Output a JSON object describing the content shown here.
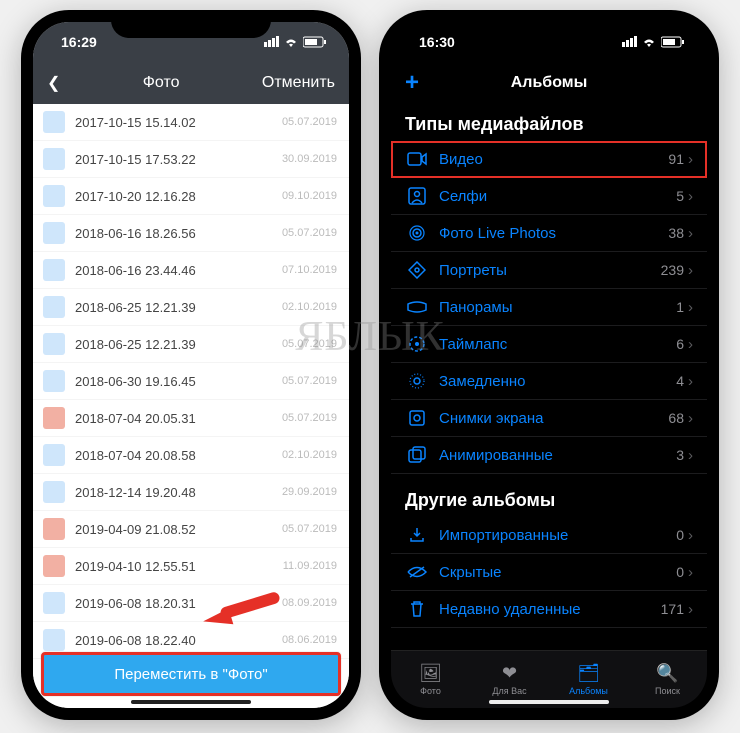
{
  "watermark": "ЯБЛЫК",
  "phone1": {
    "time": "16:29",
    "nav": {
      "title": "Фото",
      "cancel": "Отменить"
    },
    "files": [
      {
        "name": "2017-10-15 15.14.02",
        "date": "05.07.2019",
        "type": "img"
      },
      {
        "name": "2017-10-15 17.53.22",
        "date": "30.09.2019",
        "type": "img"
      },
      {
        "name": "2017-10-20 12.16.28",
        "date": "09.10.2019",
        "type": "img"
      },
      {
        "name": "2018-06-16 18.26.56",
        "date": "05.07.2019",
        "type": "img"
      },
      {
        "name": "2018-06-16 23.44.46",
        "date": "07.10.2019",
        "type": "img"
      },
      {
        "name": "2018-06-25 12.21.39",
        "date": "02.10.2019",
        "type": "img"
      },
      {
        "name": "2018-06-25 12.21.39",
        "date": "05.07.2019",
        "type": "img"
      },
      {
        "name": "2018-06-30 19.16.45",
        "date": "05.07.2019",
        "type": "img"
      },
      {
        "name": "2018-07-04 20.05.31",
        "date": "05.07.2019",
        "type": "vid"
      },
      {
        "name": "2018-07-04 20.08.58",
        "date": "02.10.2019",
        "type": "img"
      },
      {
        "name": "2018-12-14 19.20.48",
        "date": "29.09.2019",
        "type": "img"
      },
      {
        "name": "2019-04-09 21.08.52",
        "date": "05.07.2019",
        "type": "vid"
      },
      {
        "name": "2019-04-10 12.55.51",
        "date": "11.09.2019",
        "type": "vid"
      },
      {
        "name": "2019-06-08 18.20.31",
        "date": "08.09.2019",
        "type": "img"
      },
      {
        "name": "2019-06-08 18.22.40",
        "date": "08.06.2019",
        "type": "img"
      }
    ],
    "move_label": "Переместить в \"Фото\""
  },
  "phone2": {
    "time": "16:30",
    "nav_title": "Альбомы",
    "section1": "Типы медиафайлов",
    "media": [
      {
        "icon": "video-icon",
        "label": "Видео",
        "count": "91",
        "hl": true
      },
      {
        "icon": "selfie-icon",
        "label": "Селфи",
        "count": "5"
      },
      {
        "icon": "live-icon",
        "label": "Фото Live Photos",
        "count": "38"
      },
      {
        "icon": "portrait-icon",
        "label": "Портреты",
        "count": "239"
      },
      {
        "icon": "panorama-icon",
        "label": "Панорамы",
        "count": "1"
      },
      {
        "icon": "timelapse-icon",
        "label": "Таймлапс",
        "count": "6"
      },
      {
        "icon": "slowmo-icon",
        "label": "Замедленно",
        "count": "4"
      },
      {
        "icon": "screenshot-icon",
        "label": "Снимки экрана",
        "count": "68"
      },
      {
        "icon": "animated-icon",
        "label": "Анимированные",
        "count": "3"
      }
    ],
    "section2": "Другие альбомы",
    "other": [
      {
        "icon": "import-icon",
        "label": "Импортированные",
        "count": "0"
      },
      {
        "icon": "hidden-icon",
        "label": "Скрытые",
        "count": "0"
      },
      {
        "icon": "trash-icon",
        "label": "Недавно удаленные",
        "count": "171"
      }
    ],
    "tabs": [
      {
        "icon": "🖼",
        "label": "Фото"
      },
      {
        "icon": "❤",
        "label": "Для Вас"
      },
      {
        "icon": "🗂",
        "label": "Альбомы",
        "active": true
      },
      {
        "icon": "🔍",
        "label": "Поиск"
      }
    ]
  }
}
